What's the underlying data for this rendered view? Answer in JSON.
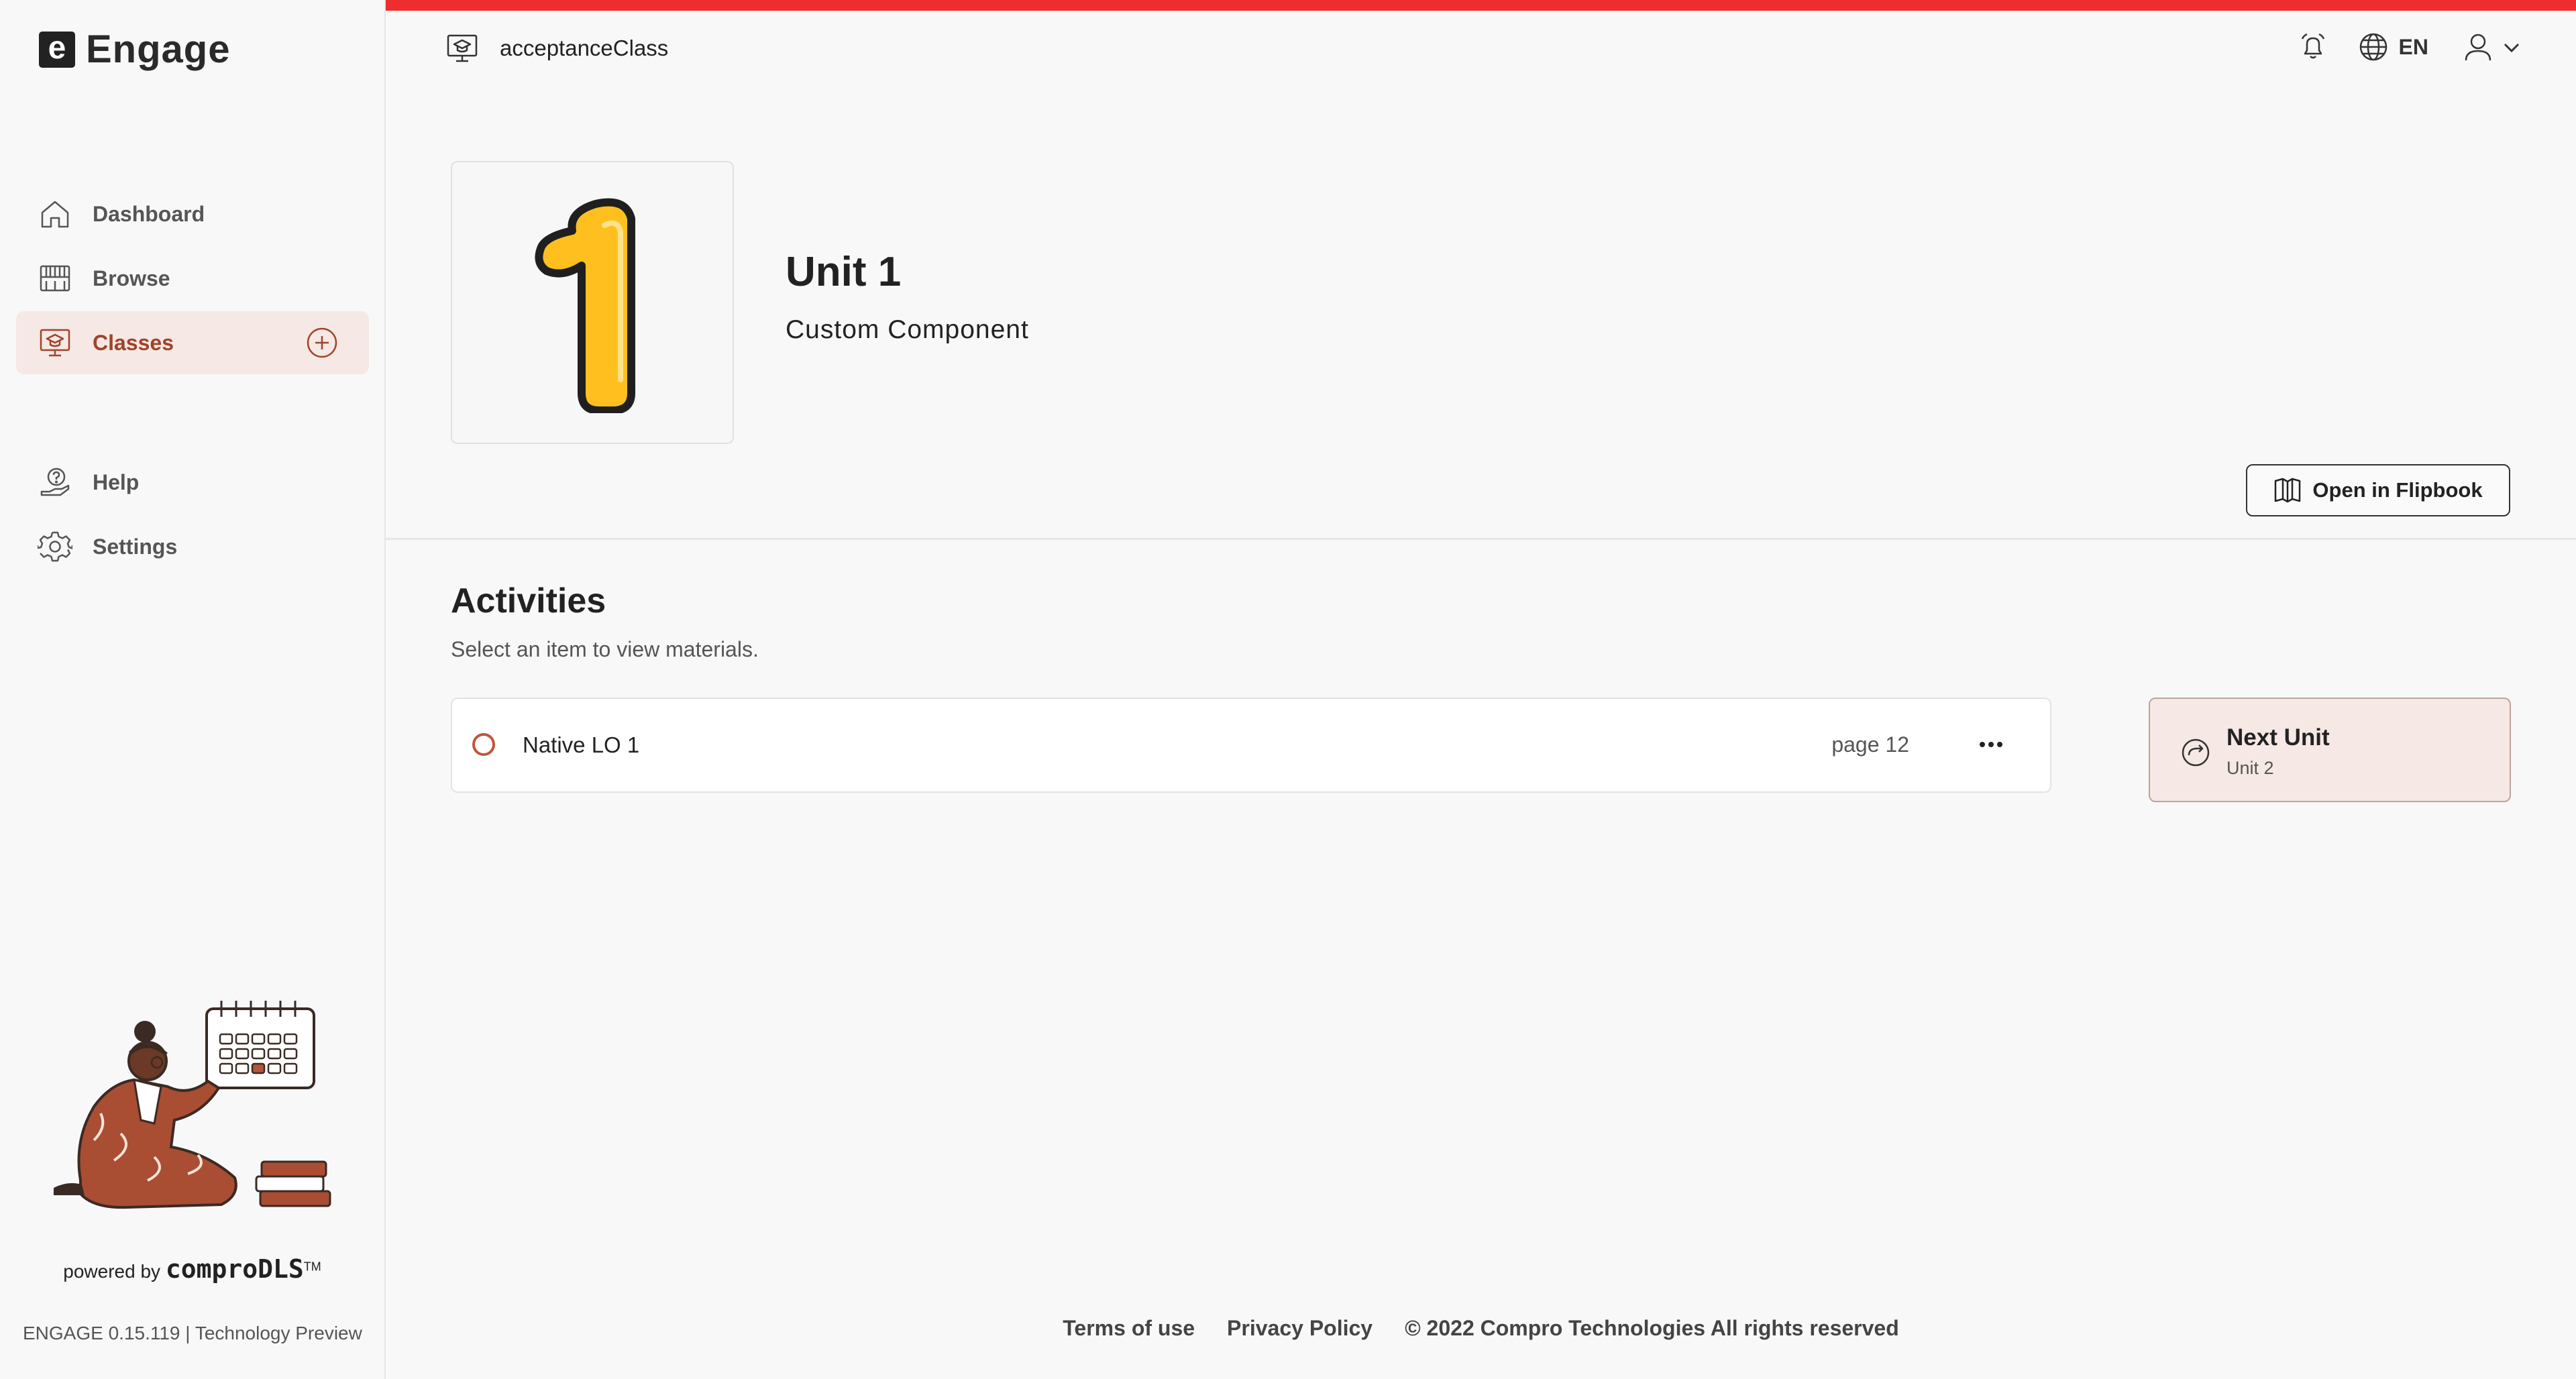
{
  "app": {
    "logo_letter": "e",
    "logo_text": "Engage"
  },
  "sidebar": {
    "items": [
      {
        "label": "Dashboard",
        "icon": "home-icon"
      },
      {
        "label": "Browse",
        "icon": "library-icon"
      },
      {
        "label": "Classes",
        "icon": "class-board-icon",
        "active": true,
        "action_icon": "plus-circle-icon"
      },
      {
        "label": "Help",
        "icon": "help-icon"
      },
      {
        "label": "Settings",
        "icon": "gear-icon"
      }
    ],
    "powered_by": "powered by",
    "brand": "comproDLS",
    "brand_tm": "TM",
    "version": "ENGAGE 0.15.119 | Technology Preview"
  },
  "header": {
    "class_name": "acceptanceClass",
    "language": "EN",
    "icons": [
      "class-board-icon",
      "alarm-bell-icon",
      "globe-icon",
      "user-icon",
      "chevron-down-icon"
    ]
  },
  "unit": {
    "number": "1",
    "title": "Unit 1",
    "subtitle": "Custom Component",
    "open_flipbook_label": "Open in Flipbook"
  },
  "activities": {
    "title": "Activities",
    "hint": "Select an item to view materials.",
    "items": [
      {
        "name": "Native LO 1",
        "page": "page 12"
      }
    ]
  },
  "next_unit": {
    "label": "Next Unit",
    "sub": "Unit 2"
  },
  "footer": {
    "terms": "Terms of use",
    "privacy": "Privacy Policy",
    "copyright": "© 2022 Compro Technologies All rights reserved"
  },
  "colors": {
    "accent": "#a0432a",
    "active_bg": "#f6e8e4",
    "top_bar": "#ee2e2e",
    "unit_number_fill": "#ffc01f"
  }
}
